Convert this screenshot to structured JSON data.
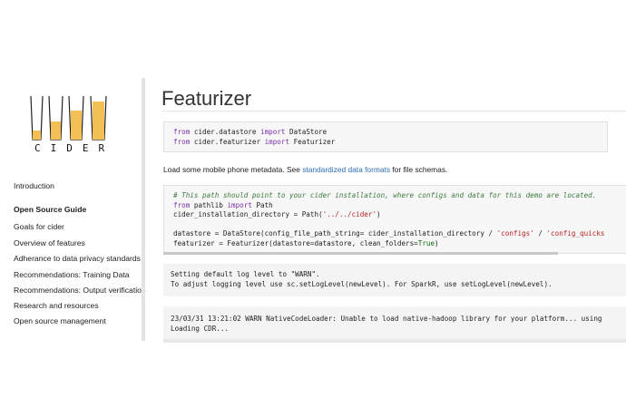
{
  "logo": {
    "text": "CIDER",
    "glass_color": "#f4bf55",
    "outline_color": "#222222"
  },
  "sidebar": {
    "items": [
      {
        "label": "Introduction",
        "type": "link"
      },
      {
        "label": "Open Source Guide",
        "type": "section"
      },
      {
        "label": "Goals for cider",
        "type": "link"
      },
      {
        "label": "Overview of features",
        "type": "link"
      },
      {
        "label": "Adherance to data privacy standards",
        "type": "link"
      },
      {
        "label": "Recommendations: Training Data",
        "type": "link"
      },
      {
        "label": "Recommendations: Output verification",
        "type": "link"
      },
      {
        "label": "Research and resources",
        "type": "link"
      },
      {
        "label": "Open source management",
        "type": "link"
      }
    ]
  },
  "main": {
    "title": "Featurizer",
    "cell1": {
      "lines": [
        "from cider.datastore import DataStore",
        "from cider.featurizer import Featurizer"
      ]
    },
    "paragraph": {
      "before": "Load some mobile phone metadata. See ",
      "link": "standardized data formats",
      "after": " for file schemas."
    },
    "cell2": {
      "lines": [
        "# This path should point to your cider installation, where configs and data for this demo are located.",
        "from pathlib import Path",
        "cider_installation_directory = Path('../../cider')",
        "",
        "datastore = DataStore(config_file_path_string= cider_installation_directory / 'configs' / 'config_quicks",
        "featurizer = Featurizer(datastore=datastore, clean_folders=True)"
      ]
    },
    "output1": {
      "lines": [
        "Setting default log level to \"WARN\".",
        "To adjust logging level use sc.setLogLevel(newLevel). For SparkR, use setLogLevel(newLevel)."
      ]
    },
    "output2": {
      "lines": [
        "23/03/31 13:21:02 WARN NativeCodeLoader: Unable to load native-hadoop library for your platform... using",
        "Loading CDR..."
      ]
    }
  },
  "colors": {
    "link": "#2a6eb7",
    "keyword": "#7a2ea6",
    "comment": "#3d7a3d",
    "string": "#b22222"
  }
}
